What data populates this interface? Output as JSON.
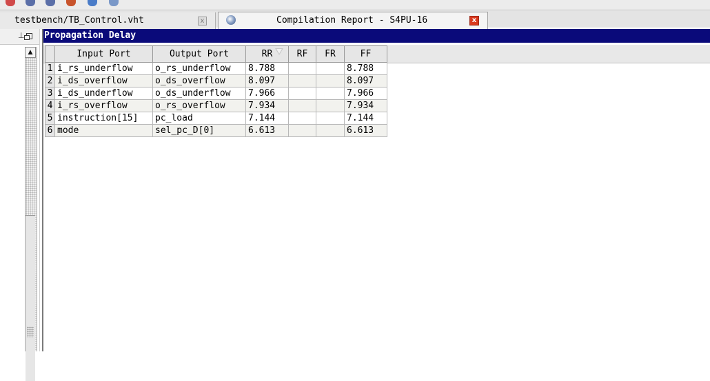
{
  "tabs": [
    {
      "label": "testbench/TB_Control.vht",
      "close": "x"
    },
    {
      "label": "Compilation Report - S4PU-16",
      "close": "x"
    }
  ],
  "report": {
    "title": "Propagation Delay",
    "columns": [
      "Input Port",
      "Output Port",
      "RR",
      "RF",
      "FR",
      "FF"
    ],
    "rows": [
      {
        "num": "1",
        "input": "i_rs_underflow",
        "output": "o_rs_underflow",
        "rr": "8.788",
        "rf": "",
        "fr": "",
        "ff": "8.788"
      },
      {
        "num": "2",
        "input": "i_ds_overflow",
        "output": "o_ds_overflow",
        "rr": "8.097",
        "rf": "",
        "fr": "",
        "ff": "8.097"
      },
      {
        "num": "3",
        "input": "i_ds_underflow",
        "output": "o_ds_underflow",
        "rr": "7.966",
        "rf": "",
        "fr": "",
        "ff": "7.966"
      },
      {
        "num": "4",
        "input": "i_rs_overflow",
        "output": "o_rs_overflow",
        "rr": "7.934",
        "rf": "",
        "fr": "",
        "ff": "7.934"
      },
      {
        "num": "5",
        "input": "instruction[15]",
        "output": "pc_load",
        "rr": "7.144",
        "rf": "",
        "fr": "",
        "ff": "7.144"
      },
      {
        "num": "6",
        "input": "mode",
        "output": "sel_pc_D[0]",
        "rr": "6.613",
        "rf": "",
        "fr": "",
        "ff": "6.613"
      }
    ],
    "sort_column": "RR"
  },
  "colors": {
    "title_bar": "#0a0a7a",
    "close_active": "#d9391e"
  }
}
